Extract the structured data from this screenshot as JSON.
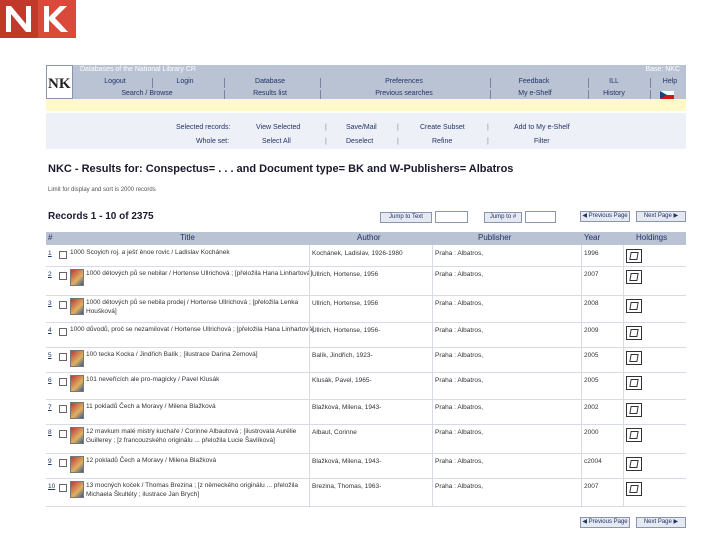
{
  "logo": {
    "text": "NK",
    "color": "#c0392b"
  },
  "app": {
    "title": "Databases of the National Library CR",
    "base": "Base:  NKC",
    "logo": "NK",
    "nav1": [
      "Logout",
      "Login",
      "Database",
      "Preferences",
      "Feedback",
      "ILL",
      "Help"
    ],
    "nav2": [
      "Search / Browse",
      "Results list",
      "Previous searches",
      "My e-Shelf",
      "History"
    ]
  },
  "selection": {
    "selected_label": "Selected records:",
    "whole_label": "Whole set:",
    "row1": [
      "View Selected",
      "Save/Mail",
      "Create Subset",
      "Add to My e-Shelf"
    ],
    "row2": [
      "Select All",
      "Deselect",
      "Refine",
      "Filter"
    ]
  },
  "results": {
    "heading": "NKC -  Results for:  Conspectus= . . . and Document type= BK and W-Publishers= Albatros",
    "limit_note": "Limit for display and sort is 2000 records",
    "records": "Records 1 - 10 of 2375",
    "jump_text": "Jump to Text",
    "jump_num": "Jump to #",
    "prev_page": "Previous Page",
    "next_page": "Next Page"
  },
  "table": {
    "headers": [
      "#",
      "Title",
      "Author",
      "Publisher",
      "Year",
      "Holdings"
    ],
    "rows": [
      {
        "num": "1",
        "title": "1000 Scoyich roj. a ješť ěnoe rovic / Ladislav Kochánek",
        "author": "Kochánek, Ladislav, 1926-1980",
        "publisher": "Praha : Albatros,",
        "year": "1996",
        "cover": false
      },
      {
        "num": "2",
        "title": "1000 dětových pů se nebilar / Hortense Ullrichová ; [přeložila Hana Linhartová]",
        "author": "Ullrich, Hortense, 1956",
        "publisher": "Praha : Albatros,",
        "year": "2007",
        "cover": true
      },
      {
        "num": "3",
        "title": "1000 dětových pů se nebila prodej / Hortense Ullrichová ; [přeložila Lenka Houšková]",
        "author": "Ullrich, Hortense, 1956",
        "publisher": "Praha : Albatros,",
        "year": "2008",
        "cover": true
      },
      {
        "num": "4",
        "title": "1000 důvodů, proč se nezamilovat / Hortense Ullrichová ; [přeložila Hana Linhartová]",
        "author": "Ullrich, Hortense, 1956-",
        "publisher": "Praha : Albatros,",
        "year": "2009",
        "cover": false
      },
      {
        "num": "5",
        "title": "100 tecka Kocka / Jindřich Balík ; [ilustrace Darina Zemová]",
        "author": "Balík, Jindřich, 1923-",
        "publisher": "Praha : Albatros,",
        "year": "2005",
        "cover": true
      },
      {
        "num": "6",
        "title": "101 neveřících ale pro-magicky / Pavel Klusák",
        "author": "Klusák, Pavel, 1965-",
        "publisher": "Praha : Albatros,",
        "year": "2005",
        "cover": true
      },
      {
        "num": "7",
        "title": "11 pokladů Čech a Moravy / Milena Blažková",
        "author": "Blažková, Milena, 1943-",
        "publisher": "Praha : Albatros,",
        "year": "2002",
        "cover": true
      },
      {
        "num": "8",
        "title": "12 mavkum malé mistry kuchaře / Corinne Albautová ; [ilustrovala Aurélie Guillerey ; [z francouzského originálu ... přeložila Lucie Šavlíková]",
        "author": "Albaut, Corinne",
        "publisher": "Praha : Albatros,",
        "year": "2000",
        "cover": true
      },
      {
        "num": "9",
        "title": "12 pokladů Čech a Moravy / Milena Blažková",
        "author": "Blažková, Milena, 1943-",
        "publisher": "Praha : Albatros,",
        "year": "c2004",
        "cover": true
      },
      {
        "num": "10",
        "title": "13 mocných koček / Thomas Brezina ; [z německého originálu ... přeložila Michaela Škultéty ; ilustrace Jan Brych]",
        "author": "Brezina, Thomas, 1963-",
        "publisher": "Praha : Albatros,",
        "year": "2007",
        "cover": true
      }
    ]
  },
  "footer": {
    "prev_page": "Previous Page",
    "next_page": "Next Page"
  }
}
